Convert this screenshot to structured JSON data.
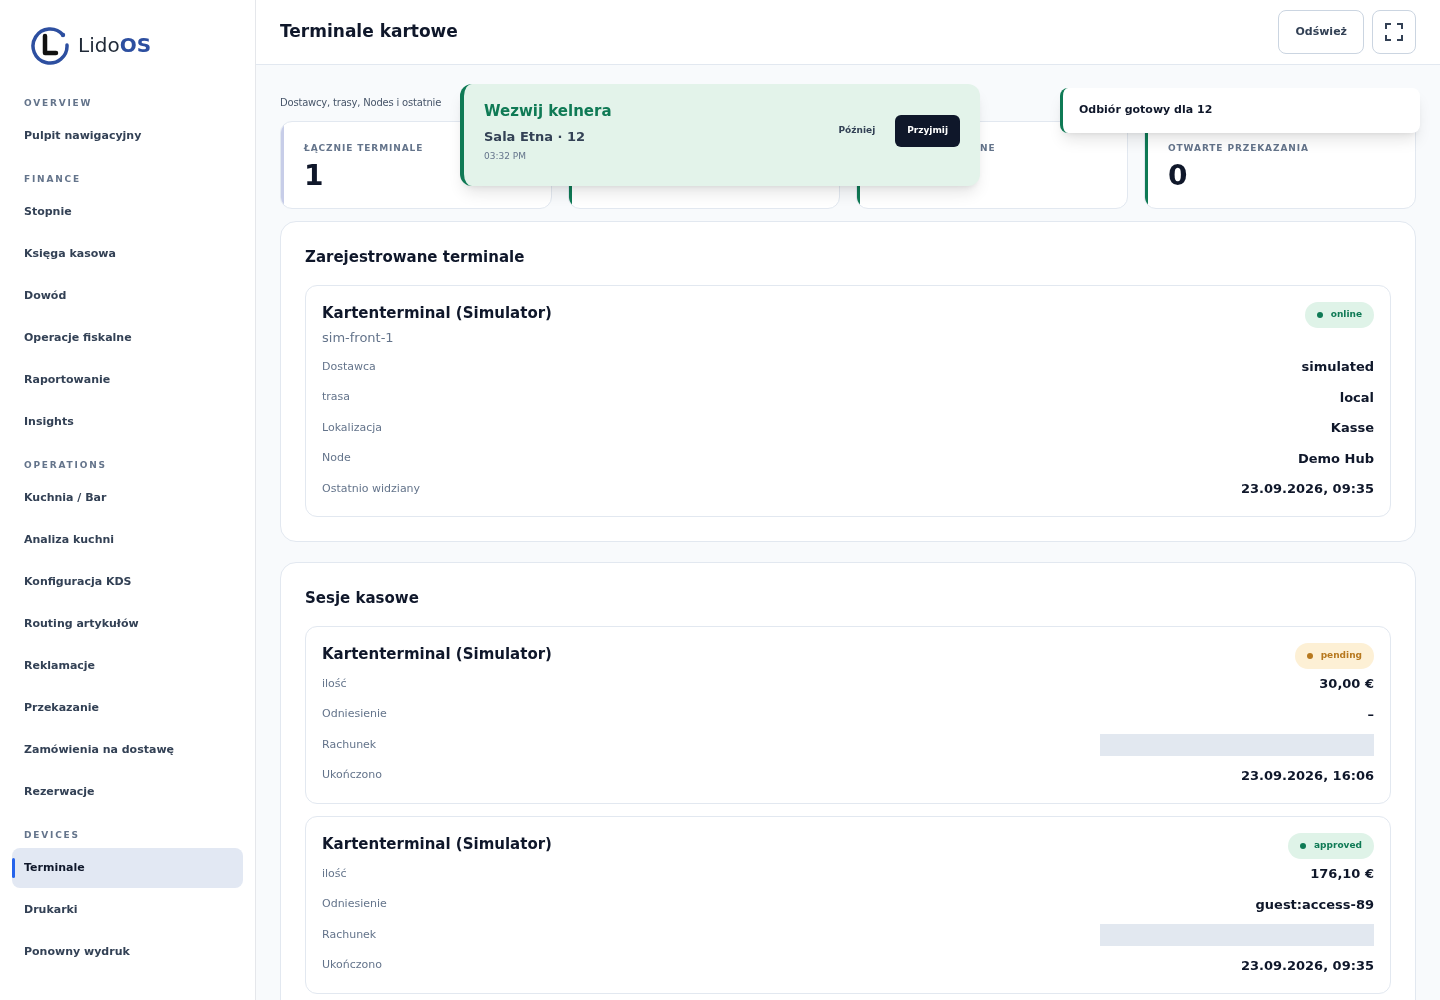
{
  "brand": {
    "name_light": "Lido",
    "name_bold": "OS"
  },
  "sidebar": {
    "sections": [
      {
        "heading": "OVERVIEW",
        "items": [
          {
            "label": "Pulpit nawigacyjny",
            "selected": false
          }
        ]
      },
      {
        "heading": "FINANCE",
        "items": [
          {
            "label": "Stopnie",
            "selected": false
          },
          {
            "label": "Księga kasowa",
            "selected": false
          },
          {
            "label": "Dowód",
            "selected": false
          },
          {
            "label": "Operacje fiskalne",
            "selected": false
          },
          {
            "label": "Raportowanie",
            "selected": false
          },
          {
            "label": "Insights",
            "selected": false
          }
        ]
      },
      {
        "heading": "OPERATIONS",
        "items": [
          {
            "label": "Kuchnia / Bar",
            "selected": false
          },
          {
            "label": "Analiza kuchni",
            "selected": false
          },
          {
            "label": "Konfiguracja KDS",
            "selected": false
          },
          {
            "label": "Routing artykułów",
            "selected": false
          },
          {
            "label": "Reklamacje",
            "selected": false
          },
          {
            "label": "Przekazanie",
            "selected": false
          },
          {
            "label": "Zamówienia na dostawę",
            "selected": false
          },
          {
            "label": "Rezerwacje",
            "selected": false
          }
        ]
      },
      {
        "heading": "DEVICES",
        "items": [
          {
            "label": "Terminale",
            "selected": true
          },
          {
            "label": "Drukarki",
            "selected": false
          },
          {
            "label": "Ponowny wydruk",
            "selected": false
          }
        ]
      }
    ]
  },
  "header": {
    "title": "Terminale kartowe",
    "refresh_button": "Odśwież"
  },
  "subtitle": "Dostawcy, trasy, Nodes i ostatnie",
  "stats": [
    {
      "label": "ŁĄCZNIE TERMINALE",
      "value": "1",
      "color": "#c7cde8"
    },
    {
      "color": "#0f7a55"
    },
    {
      "label": "NE",
      "color": "#0f7a55"
    },
    {
      "label": "OTWARTE PRZEKAZANIA",
      "value": "0",
      "color": "#0f7a55"
    }
  ],
  "terminals": {
    "title": "Zarejestrowane terminale",
    "items": [
      {
        "name": "Kartenterminal (Simulator)",
        "id": "sim-front-1",
        "status": "online",
        "rows": [
          {
            "label": "Dostawca",
            "value": "simulated"
          },
          {
            "label": "trasa",
            "value": "local"
          },
          {
            "label": "Lokalizacja",
            "value": "Kasse"
          },
          {
            "label": "Node",
            "value": "Demo Hub"
          },
          {
            "label": "Ostatnio widziany",
            "value": "23.09.2026, 09:35"
          }
        ]
      }
    ]
  },
  "sessions": {
    "title": "Sesje kasowe",
    "items": [
      {
        "name": "Kartenterminal (Simulator)",
        "status": "pending",
        "rows": [
          {
            "label": "ilość",
            "value": "30,00 €"
          },
          {
            "label": "Odniesienie",
            "value": "–"
          },
          {
            "label": "Rachunek",
            "loading": true
          },
          {
            "label": "Ukończono",
            "value": "23.09.2026, 16:06"
          }
        ]
      },
      {
        "name": "Kartenterminal (Simulator)",
        "status": "approved",
        "rows": [
          {
            "label": "ilość",
            "value": "176,10 €"
          },
          {
            "label": "Odniesienie",
            "value": "guest:access-89"
          },
          {
            "label": "Rachunek",
            "loading": true
          },
          {
            "label": "Ukończono",
            "value": "23.09.2026, 09:35"
          }
        ]
      }
    ]
  },
  "toasts": [
    {
      "kind": "call",
      "title": "Wezwij kelnera",
      "detail": "Sala Etna · 12",
      "time": "03:32 PM",
      "later_button": "Później",
      "accept_button": "Przyjmij"
    },
    {
      "kind": "info",
      "title": "Odbiór gotowy dla 12"
    }
  ]
}
